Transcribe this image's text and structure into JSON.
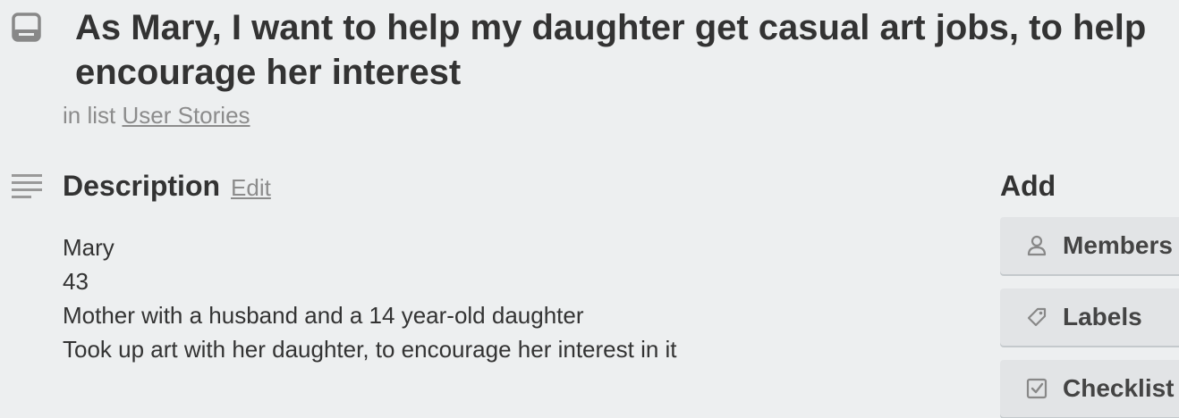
{
  "card": {
    "title": "As Mary, I want to help my daughter get casual art jobs, to help encourage her interest",
    "in_list_prefix": "in list",
    "list_name": "User Stories",
    "icon": "card-icon"
  },
  "description": {
    "heading": "Description",
    "edit_label": "Edit",
    "icon": "description-lines-icon",
    "lines": [
      "Mary",
      "43",
      "Mother with a husband and a 14 year-old daughter",
      "Took up art with her daughter, to encourage her interest in it"
    ]
  },
  "sidebar": {
    "heading": "Add",
    "buttons": [
      {
        "label": "Members",
        "icon": "person-icon"
      },
      {
        "label": "Labels",
        "icon": "tag-icon"
      },
      {
        "label": "Checklist",
        "icon": "checkbox-icon"
      }
    ]
  },
  "colors": {
    "background": "#edeff0",
    "text": "#333333",
    "muted": "#8c8c8c",
    "button_bg": "#e2e4e6",
    "button_shadow": "#c4c9cc"
  }
}
